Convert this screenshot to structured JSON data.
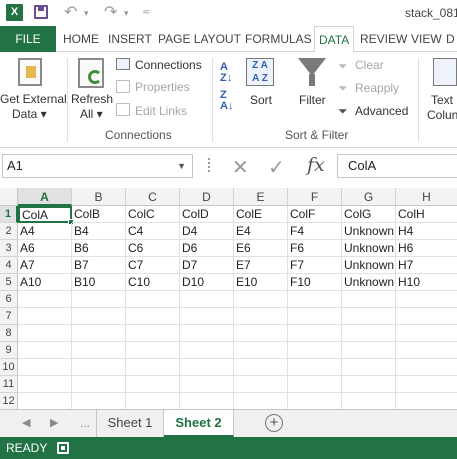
{
  "app": {
    "logo_text": "X",
    "title": "stack_081"
  },
  "quick_access": {
    "save": "save-icon",
    "undo": "undo-icon",
    "redo": "redo-icon",
    "customize": "customize-icon"
  },
  "tabs": {
    "file": "FILE",
    "items": [
      "HOME",
      "INSERT",
      "PAGE LAYOUT",
      "FORMULAS",
      "DATA",
      "REVIEW",
      "VIEW",
      "D"
    ],
    "active": "DATA"
  },
  "ribbon": {
    "get_external_data": {
      "line1": "Get External",
      "line2": "Data ▾"
    },
    "refresh": {
      "line1": "Refresh",
      "line2": "All ▾"
    },
    "connections": "Connections",
    "properties": "Properties",
    "edit_links": "Edit Links",
    "connections_group": "Connections",
    "sort_az": "A↓Z",
    "sort": "Sort",
    "filter": "Filter",
    "clear": "Clear",
    "reapply": "Reapply",
    "advanced": "Advanced",
    "sort_filter_group": "Sort & Filter",
    "text_to_columns": {
      "line1": "Text",
      "line2": "Colun"
    }
  },
  "formula_bar": {
    "name_box": "A1",
    "cancel_glyph": "✕",
    "enter_glyph": "✓",
    "fx": "fx",
    "value": "ColA"
  },
  "grid": {
    "columns": [
      "A",
      "B",
      "C",
      "D",
      "E",
      "F",
      "G",
      "H"
    ],
    "rows": [
      "1",
      "2",
      "3",
      "4",
      "5",
      "6",
      "7",
      "8",
      "9",
      "10",
      "11",
      "12"
    ],
    "cells": [
      [
        "ColA",
        "ColB",
        "ColC",
        "ColD",
        "ColE",
        "ColF",
        "ColG",
        "ColH"
      ],
      [
        "A4",
        "B4",
        "C4",
        "D4",
        "E4",
        "F4",
        "Unknown",
        "H4"
      ],
      [
        "A6",
        "B6",
        "C6",
        "D6",
        "E6",
        "F6",
        "Unknown",
        "H6"
      ],
      [
        "A7",
        "B7",
        "C7",
        "D7",
        "E7",
        "F7",
        "Unknown",
        "H7"
      ],
      [
        "A10",
        "B10",
        "C10",
        "D10",
        "E10",
        "F10",
        "Unknown",
        "H10"
      ]
    ],
    "active_cell": "A1"
  },
  "sheets": {
    "tabs": [
      "Sheet 1",
      "Sheet 2"
    ],
    "active": "Sheet 2",
    "add_label": "+",
    "dots": "..."
  },
  "status": {
    "text": "READY"
  },
  "colors": {
    "accent": "#217346",
    "file_tab": "#217346",
    "status_bar": "#217346"
  }
}
